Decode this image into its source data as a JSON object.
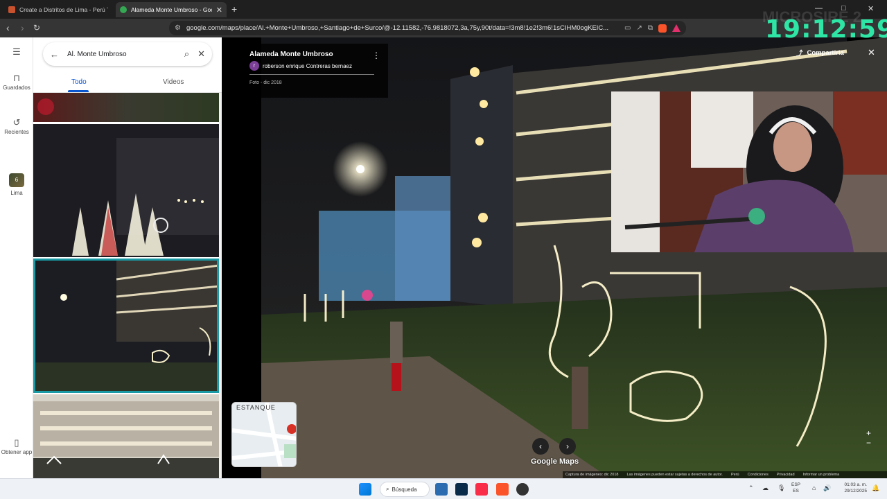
{
  "browser": {
    "tabs": [
      {
        "title": "Create a Distritos de Lima - Perú Tier",
        "active": false
      },
      {
        "title": "Alameda Monte Umbroso - Goo",
        "active": true
      }
    ],
    "new_tab_symbol": "+",
    "url": "google.com/maps/place/Al.+Monte+Umbroso,+Santiago+de+Surco/@-12.11582,-76.9818072,3a,75y,90t/data=!3m8!1e2!3m6!1sCIHM0ogKEIC...",
    "window_controls": [
      "—",
      "□",
      "✕"
    ]
  },
  "rail": {
    "items": [
      {
        "label": "Guardados",
        "icon": "bookmark-icon"
      },
      {
        "label": "Recientes",
        "icon": "history-icon"
      },
      {
        "label": "Lima",
        "icon": "lima-thumbnail"
      },
      {
        "label": "Obtener app",
        "icon": "phone-icon"
      }
    ],
    "lima_badge": "6"
  },
  "search": {
    "query": "Al. Monte Umbroso"
  },
  "photo_tabs": {
    "all": "Todo",
    "videos": "Videos",
    "active": "Todo"
  },
  "viewer": {
    "place_title": "Alameda Monte Umbroso",
    "author_initial": "r",
    "author_name": "roberson enrique Contreras bernaez",
    "photo_date": "Foto - dic 2018",
    "share_label": "Compartirla",
    "brand": "Google Maps",
    "minimap_label": "ESTANQUE",
    "footer": {
      "capture": "Captura de imágenes: dic 2018",
      "rights": "Las imágenes pueden estar sujetas a derechos de autor.",
      "country": "Perú",
      "terms": "Condiciones",
      "privacy": "Privacidad",
      "report": "Informar un problema"
    }
  },
  "overlay": {
    "clock": "19:12:59",
    "watermark": "MICROSIRE 2"
  },
  "taskbar": {
    "search_label": "Búsqueda",
    "lang_top": "ESP",
    "lang_bottom": "ES",
    "time": "01:03 a. m.",
    "date": "29/12/2025"
  },
  "colors": {
    "accent": "#0b57d0",
    "selected_outline": "#1a9aa4",
    "clock": "#2ee6a6"
  }
}
